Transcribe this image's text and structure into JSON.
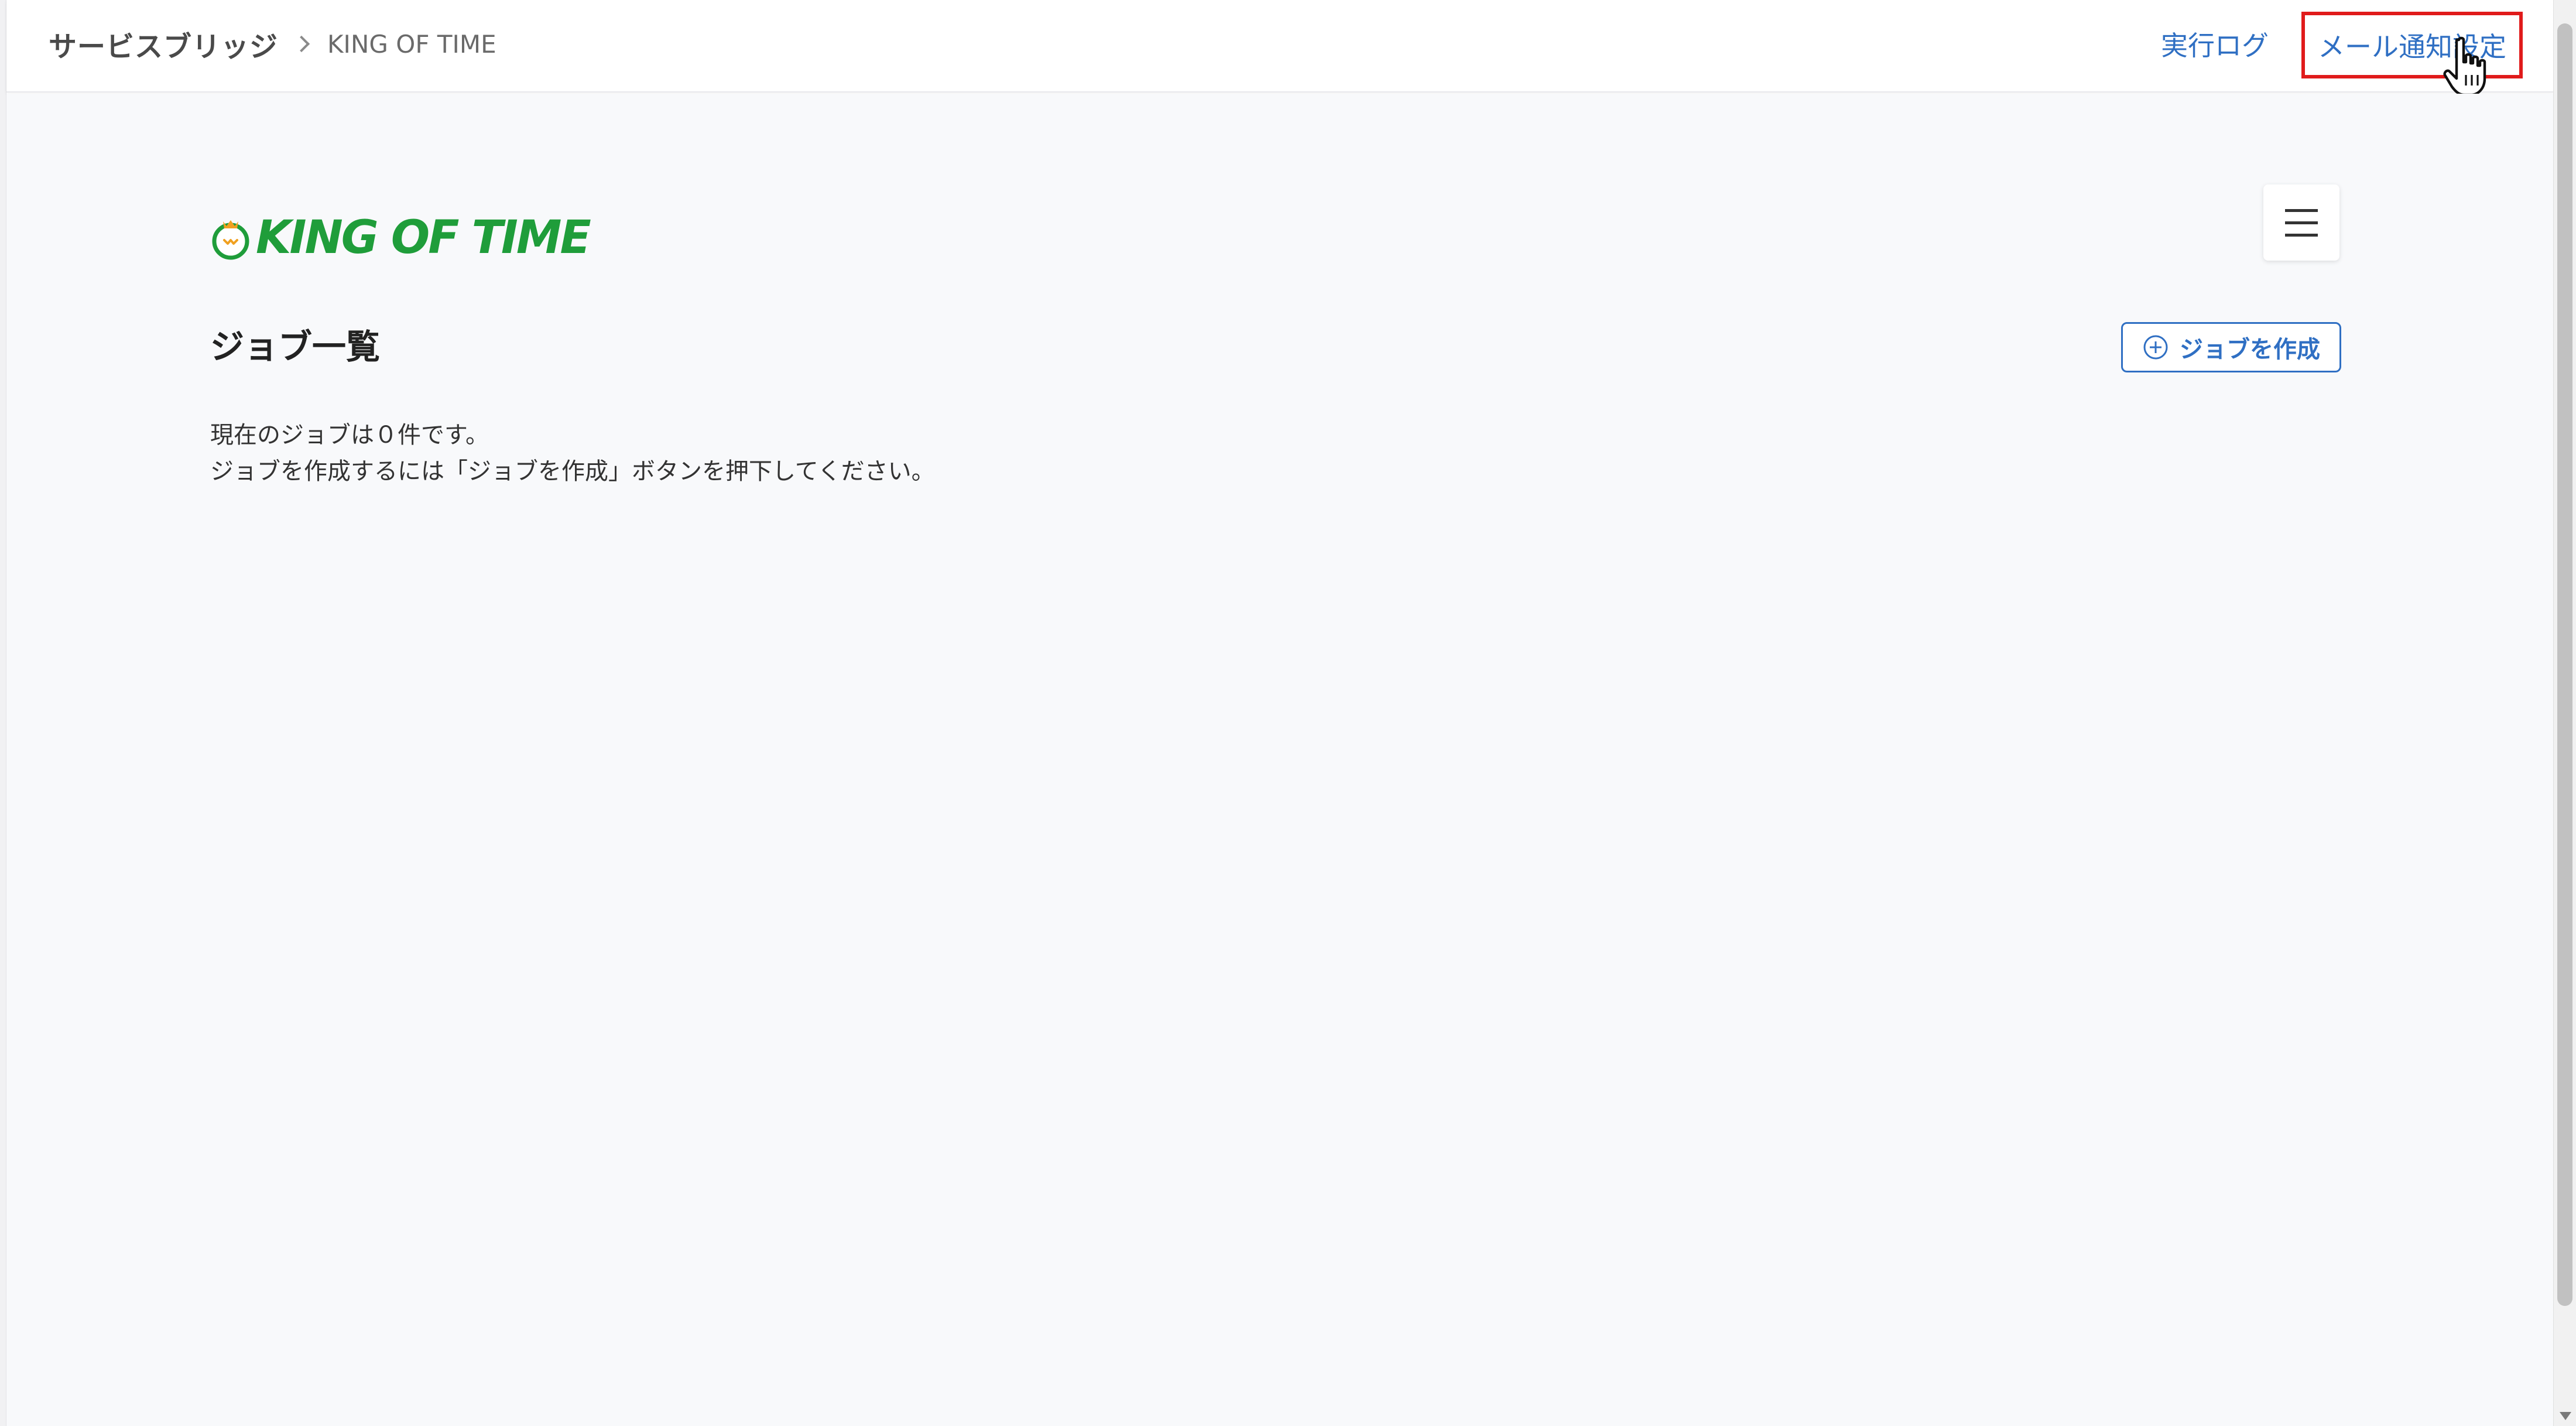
{
  "header": {
    "breadcrumb_root": "サービスブリッジ",
    "breadcrumb_current": "KING OF TIME",
    "link_log": "実行ログ",
    "link_mail": "メール通知設定"
  },
  "logo": {
    "text": "KING OF TIME",
    "brand_color": "#1f9d3a"
  },
  "main": {
    "title": "ジョブ一覧",
    "create_button_label": "ジョブを作成",
    "empty_line1": "現在のジョブは０件です。",
    "empty_line2": "ジョブを作成するには「ジョブを作成」ボタンを押下してください。"
  },
  "icons": {
    "menu": "hamburger-icon",
    "create": "plus-circle-icon",
    "cursor": "hand-pointer-icon",
    "breadcrumb_sep": "chevron-right-icon"
  },
  "colors": {
    "link": "#2f6fc3",
    "highlight": "#e01b1b"
  }
}
